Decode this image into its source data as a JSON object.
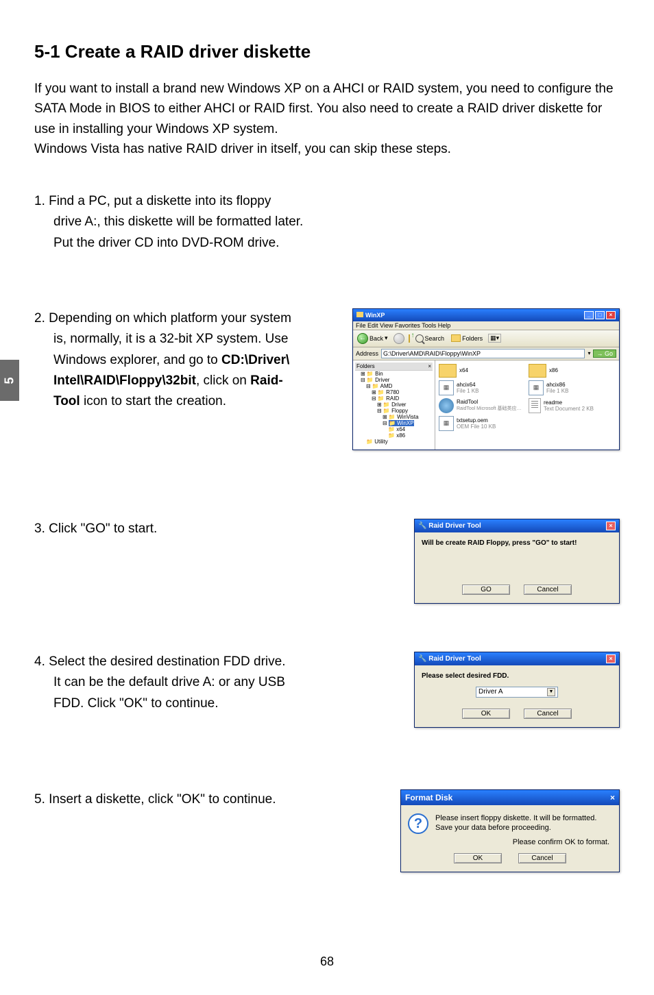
{
  "side_tab": "5",
  "heading": "5-1 Create a RAID driver diskette",
  "intro": "If you want to install a brand new Windows XP on a AHCI or RAID system, you need to configure the SATA Mode in BIOS to either AHCI or RAID first. You also need to create a RAID driver diskette for use in installing your Windows XP system.\nWindows Vista has native RAID driver in itself, you can skip these steps.",
  "steps": {
    "s1": {
      "num": "1.",
      "line1": "Find a PC, put a diskette into its floppy",
      "line2": "drive A:, this diskette will be formatted later.",
      "line3": "Put the driver CD into DVD-ROM drive."
    },
    "s2": {
      "num": "2.",
      "line1": "Depending on which platform your system",
      "line2": "is, normally, it is a 32-bit XP system. Use",
      "line3": "Windows explorer, and go to ",
      "bold1": "CD:\\Driver\\",
      "bold2": "Intel\\RAID\\Floppy\\32bit",
      "line4": ", click on ",
      "bold3": "Raid-",
      "bold4": "Tool",
      "line5": " icon to start the creation."
    },
    "s3": {
      "num": "3.",
      "text": "Click \"GO\" to start."
    },
    "s4": {
      "num": "4.",
      "line1": "Select the desired destination FDD drive.",
      "line2": "It can be the default drive A: or any USB",
      "line3": "FDD. Click \"OK\" to continue."
    },
    "s5": {
      "num": "5.",
      "text": "Insert a diskette, click \"OK\" to continue."
    }
  },
  "explorer": {
    "title": "WinXP",
    "menu": "File   Edit   View   Favorites   Tools   Help",
    "back": "Back",
    "search": "Search",
    "folders": "Folders",
    "address_label": "Address",
    "address": "G:\\Driver\\AMD\\RAID\\Floppy\\WinXP",
    "go": "Go",
    "tree_header": "Folders",
    "tree": {
      "bin": "Bin",
      "driver": "Driver",
      "amd": "AMD",
      "r780": "R780",
      "raid": "RAID",
      "driver2": "Driver",
      "floppy": "Floppy",
      "winvista": "WinVista",
      "winxp": "WinXP",
      "x64": "x64",
      "x86": "x86",
      "utility": "Utility"
    },
    "files": {
      "x64": {
        "name": "x64"
      },
      "x86": {
        "name": "x86"
      },
      "ahcix64": {
        "name": "ahcix64",
        "meta": "File\n1 KB"
      },
      "ahcix86": {
        "name": "ahcix86",
        "meta": "File\n1 KB"
      },
      "raidtool": {
        "name": "RaidTool",
        "meta": "RaidTool Microsoft 基础类应…"
      },
      "readme": {
        "name": "readme",
        "meta": "Text Document\n2 KB"
      },
      "txtsetup": {
        "name": "txtsetup.oem",
        "meta": "OEM File\n10 KB"
      }
    }
  },
  "dlg_go": {
    "title": "Raid Driver Tool",
    "text": "Will be create RAID Floppy, press \"GO\" to start!",
    "go": "GO",
    "cancel": "Cancel"
  },
  "dlg_fdd": {
    "title": "Raid Driver Tool",
    "text": "Please select desired FDD.",
    "option": "Driver A",
    "ok": "OK",
    "cancel": "Cancel"
  },
  "dlg_format": {
    "title": "Format Disk",
    "line1": "Please insert floppy diskette.  It will be formatted.",
    "line2": "Save your data before proceeding.",
    "confirm": "Please confirm OK to format.",
    "ok": "OK",
    "cancel": "Cancel"
  },
  "pagenum": "68"
}
